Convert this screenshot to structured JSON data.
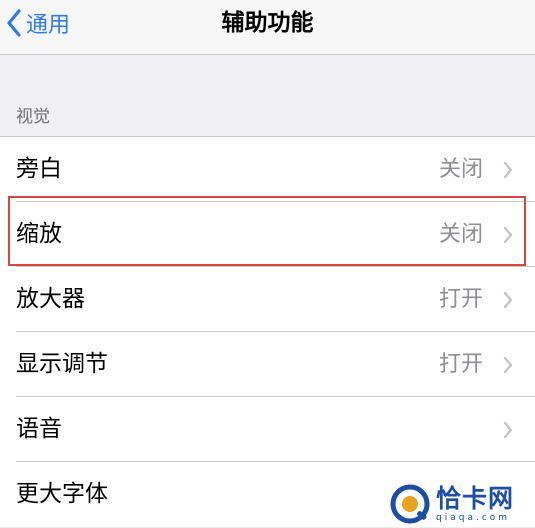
{
  "navbar": {
    "back_label": "通用",
    "title": "辅助功能"
  },
  "section": {
    "header": "视觉"
  },
  "rows": [
    {
      "label": "旁白",
      "value": "关闭"
    },
    {
      "label": "缩放",
      "value": "关闭"
    },
    {
      "label": "放大器",
      "value": "打开"
    },
    {
      "label": "显示调节",
      "value": "打开"
    },
    {
      "label": "语音",
      "value": ""
    },
    {
      "label": "更大字体",
      "value": ""
    }
  ],
  "watermark": {
    "main": "恰卡网",
    "sub": "qiaqa.com"
  },
  "colors": {
    "accent": "#2f7bf5",
    "highlight": "#d9463e",
    "background": "#efeff4",
    "secondary_text": "#8e8e93"
  },
  "icons": [
    "chevron-left-icon",
    "chevron-right-icon",
    "watermark-logo"
  ]
}
